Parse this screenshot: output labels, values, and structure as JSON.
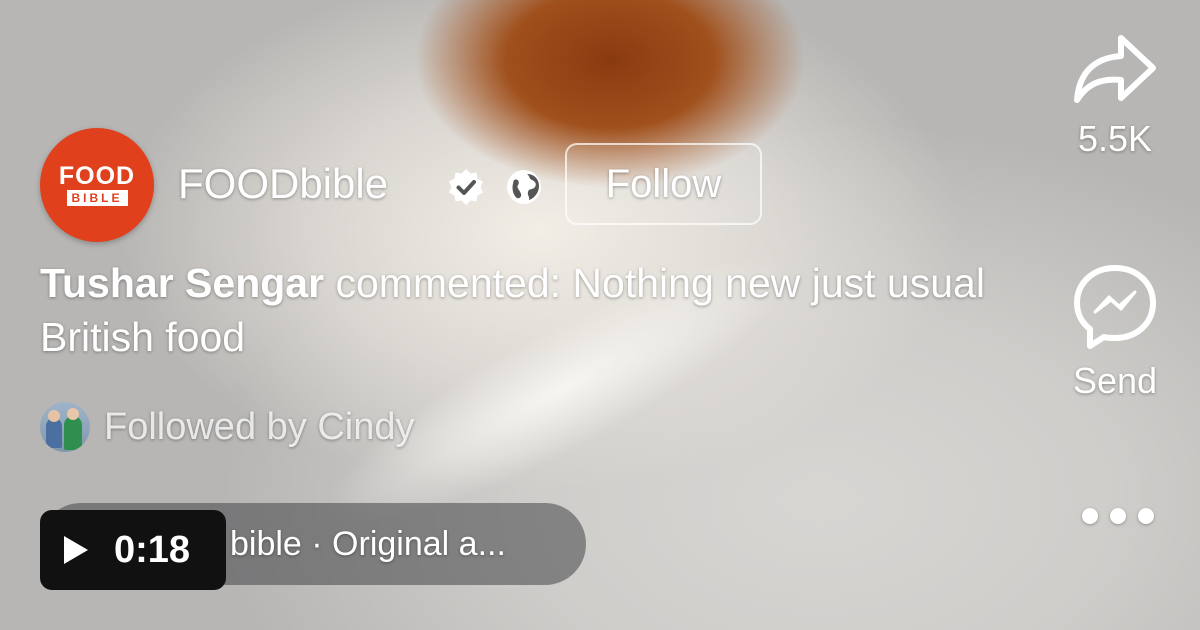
{
  "page": {
    "logo_top": "FOOD",
    "logo_bottom": "BIBLE",
    "name": "FOODbible",
    "follow_label": "Follow"
  },
  "caption": {
    "author": "Tushar Sengar",
    "text": " commented: Nothing new just usual British food"
  },
  "followed_by": {
    "text": "Followed by Cindy"
  },
  "audio": {
    "label": "bible · Original a..."
  },
  "video": {
    "duration": "0:18"
  },
  "actions": {
    "share_count": "5.5K",
    "send_label": "Send"
  },
  "icons": [
    "verified-badge-icon",
    "globe-icon",
    "share-icon",
    "messenger-icon",
    "more-icon",
    "play-icon"
  ],
  "colors": {
    "logo_red": "#e0401c",
    "text": "#ffffff",
    "badge_bg": "#111111"
  }
}
